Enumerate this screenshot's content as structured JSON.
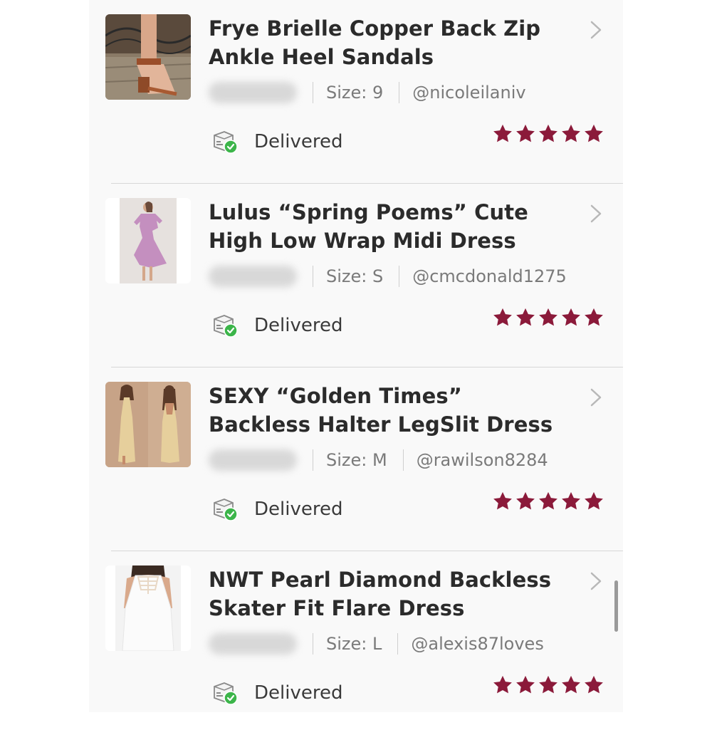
{
  "colors": {
    "star": "#8b1a3a",
    "delivered_check": "#3cb54a",
    "title_text": "#2b2b2b",
    "meta_text": "#7a7a7a"
  },
  "orders": [
    {
      "title": "Frye Brielle Copper Back Zip Ankle Heel Sandals",
      "size": "Size: 9",
      "username": "@nicoleilaniv",
      "status": "Delivered",
      "rating": 5,
      "thumb_icon": "sandal-photo"
    },
    {
      "title": "Lulus “Spring Poems” Cute High Low Wrap Midi Dress",
      "size": "Size: S",
      "username": "@cmcdonald1275",
      "status": "Delivered",
      "rating": 5,
      "thumb_icon": "lilac-dress-photo"
    },
    {
      "title": "SEXY “Golden Times” Backless Halter LegSlit Dress",
      "size": "Size: M",
      "username": "@rawilson8284",
      "status": "Delivered",
      "rating": 5,
      "thumb_icon": "gold-dress-photo"
    },
    {
      "title": "NWT Pearl Diamond Backless Skater Fit Flare Dress",
      "size": "Size: L",
      "username": "@alexis87loves",
      "status": "Delivered",
      "rating": 5,
      "thumb_icon": "white-dress-photo"
    }
  ]
}
